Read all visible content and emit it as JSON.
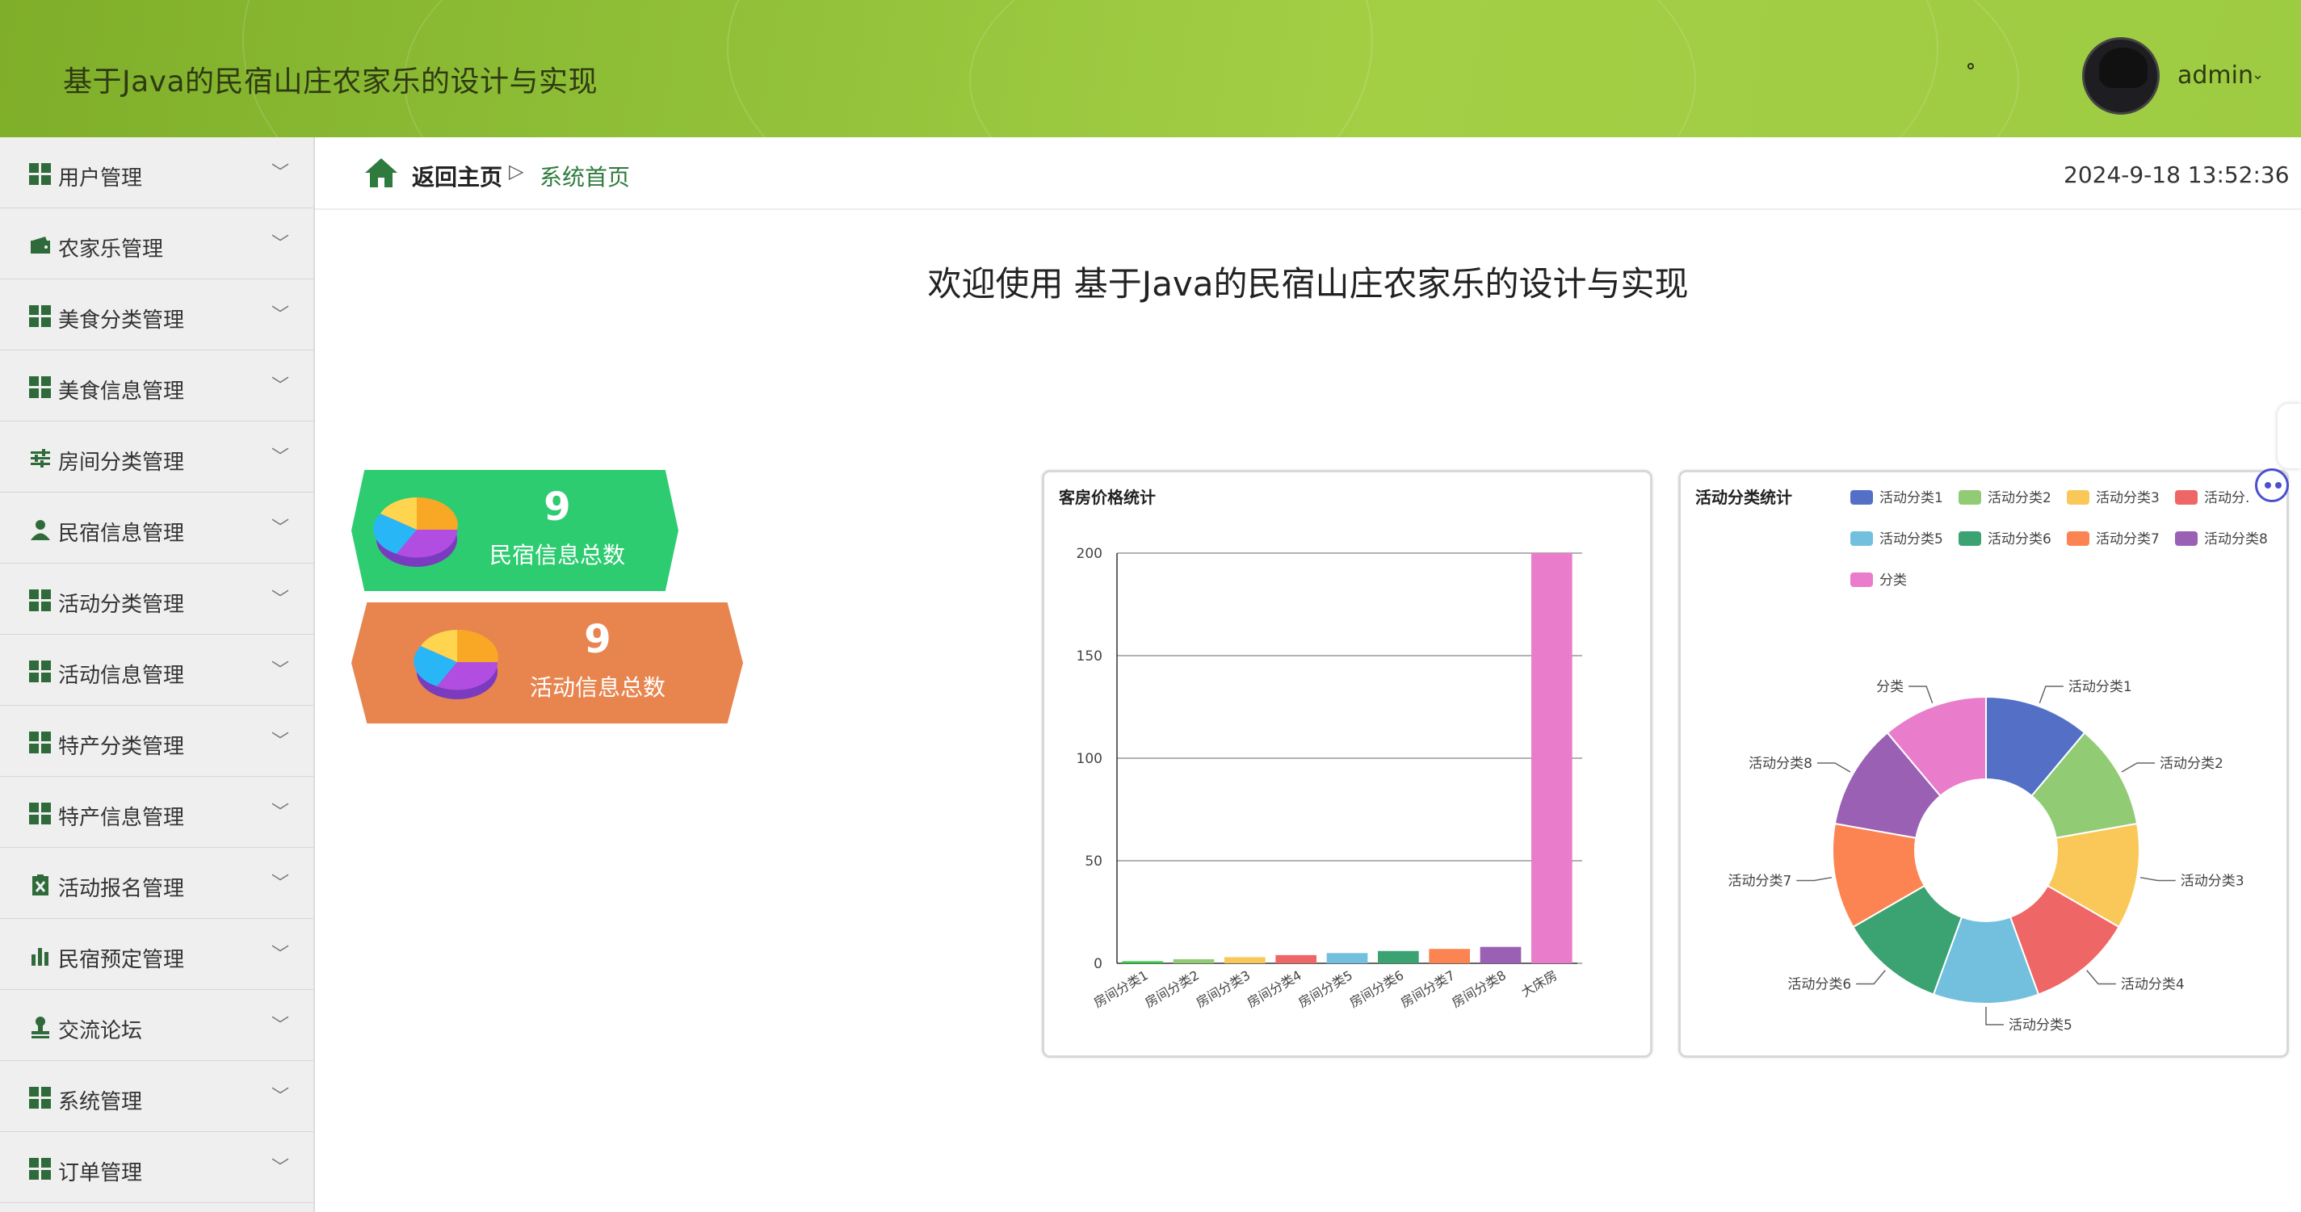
{
  "header": {
    "site_title": "基于Java的民宿山庄农家乐的设计与实现",
    "dot_mark": "°",
    "username": "admin"
  },
  "sidebar": {
    "items": [
      {
        "label": "用户管理",
        "icon": "grid-icon"
      },
      {
        "label": "农家乐管理",
        "icon": "wallet-icon"
      },
      {
        "label": "美食分类管理",
        "icon": "grid-icon"
      },
      {
        "label": "美食信息管理",
        "icon": "grid-icon"
      },
      {
        "label": "房间分类管理",
        "icon": "sliders-icon"
      },
      {
        "label": "民宿信息管理",
        "icon": "user-icon"
      },
      {
        "label": "活动分类管理",
        "icon": "grid-icon"
      },
      {
        "label": "活动信息管理",
        "icon": "grid-icon"
      },
      {
        "label": "特产分类管理",
        "icon": "grid-icon"
      },
      {
        "label": "特产信息管理",
        "icon": "grid-icon"
      },
      {
        "label": "活动报名管理",
        "icon": "clipboard-icon"
      },
      {
        "label": "民宿预定管理",
        "icon": "bar-chart-icon"
      },
      {
        "label": "交流论坛",
        "icon": "stamp-icon"
      },
      {
        "label": "系统管理",
        "icon": "grid-icon"
      },
      {
        "label": "订单管理",
        "icon": "grid-icon"
      }
    ]
  },
  "breadcrumb": {
    "home": "返回主页",
    "separator": "▷",
    "current": "系统首页"
  },
  "clock": "2024-9-18 13:52:36",
  "welcome": "欢迎使用 基于Java的民宿山庄农家乐的设计与实现",
  "stats": [
    {
      "value": "9",
      "label": "民宿信息总数",
      "color": "#2ecc71"
    },
    {
      "value": "9",
      "label": "活动信息总数",
      "color": "#e8854f"
    }
  ],
  "chart_data": [
    {
      "type": "bar",
      "title": "客房价格统计",
      "categories": [
        "房间分类1",
        "房间分类2",
        "房间分类3",
        "房间分类4",
        "房间分类5",
        "房间分类6",
        "房间分类7",
        "房间分类8",
        "大床房"
      ],
      "values": [
        1,
        2,
        3,
        4,
        5,
        6,
        7,
        8,
        200
      ],
      "colors": [
        "#2ecc40",
        "#91cc75",
        "#fac858",
        "#ee6666",
        "#73c0de",
        "#3ba272",
        "#fc8452",
        "#9a60b4",
        "#ea7ccc"
      ],
      "ylim": [
        0,
        200
      ],
      "yticks": [
        0,
        50,
        100,
        150,
        200
      ],
      "grid": true
    },
    {
      "type": "pie",
      "title": "活动分类统计",
      "legend_position": "top",
      "categories": [
        "活动分类1",
        "活动分类2",
        "活动分类3",
        "活动分类4",
        "活动分类5",
        "活动分类6",
        "活动分类7",
        "活动分类8",
        "分类"
      ],
      "legend_labels": [
        "活动分类1",
        "活动分类2",
        "活动分类3",
        "活动分.",
        "活动分类5",
        "活动分类6",
        "活动分类7",
        "活动分类8",
        "分类"
      ],
      "values": [
        1,
        1,
        1,
        1,
        1,
        1,
        1,
        1,
        1
      ],
      "colors": [
        "#5470c6",
        "#91cc75",
        "#fac858",
        "#ee6666",
        "#73c0de",
        "#3ba272",
        "#fc8452",
        "#9a60b4",
        "#ea7ccc"
      ],
      "donut": true
    }
  ]
}
